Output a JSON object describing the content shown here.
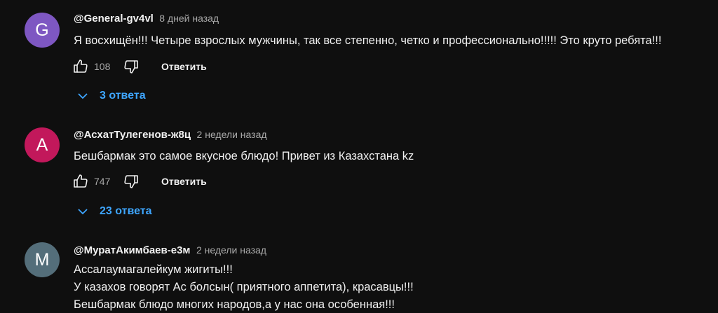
{
  "colors": {
    "background": "#0f0f0f",
    "text_primary": "#f1f1f1",
    "text_secondary": "#aaaaaa",
    "link_blue": "#3ea6ff"
  },
  "actions": {
    "reply_label": "Ответить",
    "like_icon": "thumb-up-icon",
    "dislike_icon": "thumb-down-icon",
    "replies_icon": "chevron-down-icon"
  },
  "comments": [
    {
      "avatar_letter": "G",
      "avatar_color": "#7e57c2",
      "author": "@General-gv4vl",
      "time": "8 дней назад",
      "lines": [
        "Я восхищён!!! Четыре взрослых мужчины, так все степенно, четко и профессионально!!!!! Это круто ребята!!!"
      ],
      "likes": "108",
      "replies": "3 ответа"
    },
    {
      "avatar_letter": "A",
      "avatar_color": "#c2185b",
      "author": "@АсхатТулегенов-ж8ц",
      "time": "2 недели назад",
      "lines": [
        "Бешбармак это самое вкусное блюдо! Привет из Казахстана kz"
      ],
      "likes": "747",
      "replies": "23 ответа"
    },
    {
      "avatar_letter": "M",
      "avatar_color": "#546e7a",
      "author": "@МуратАкимбаев-е3м",
      "time": "2 недели назад",
      "lines": [
        "Ассалаумагалейкум жигиты!!!",
        "У казахов говорят Ас болсын( приятного аппетита), красавцы!!!",
        "Бешбармак блюдо многих народов,а у нас она особенная!!!"
      ]
    }
  ]
}
